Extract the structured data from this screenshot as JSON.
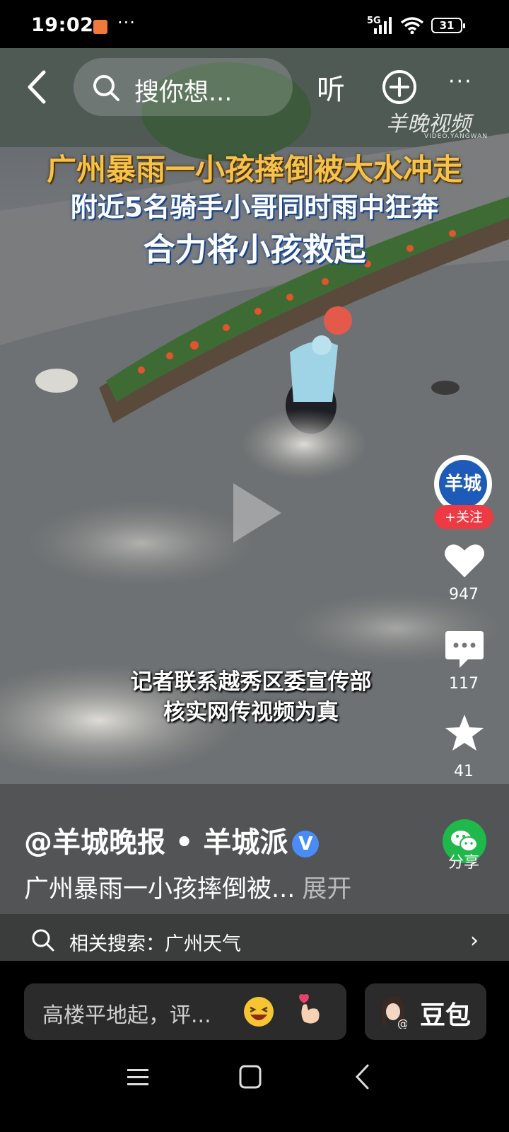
{
  "status": {
    "time": "19:02",
    "network": "5G",
    "battery": "31"
  },
  "topbar": {
    "search_placeholder": "搜你想...",
    "listen_label": "听"
  },
  "watermark": {
    "brand": "羊晚视频",
    "sub": "VIDEO.YANGWAN"
  },
  "captions": {
    "line1": "广州暴雨一小孩摔倒被大水冲走",
    "line2": "附近5名骑手小哥同时雨中狂奔",
    "line3": "合力将小孩救起"
  },
  "subtitles": {
    "line1": "记者联系越秀区委宣传部",
    "line2": "核实网传视频为真"
  },
  "rail": {
    "avatar_text": "羊城",
    "follow_label": "+关注",
    "likes": "947",
    "comments": "117",
    "favorites": "41",
    "share_label": "分享"
  },
  "post": {
    "author": "@羊城晚报 • 羊城派",
    "verified": "V",
    "description": "广州暴雨一小孩摔倒被...",
    "expand": "展开"
  },
  "related": {
    "label": "相关搜索：广州天气"
  },
  "playback": {
    "progress": 0.7
  },
  "bottom": {
    "comment_placeholder": "高楼平地起，评...",
    "assistant_label": "豆包"
  }
}
